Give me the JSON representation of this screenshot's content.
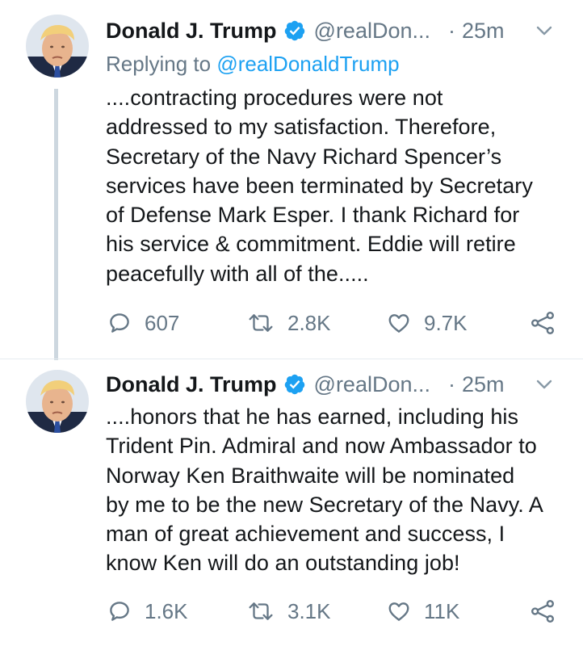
{
  "colors": {
    "text": "#14171a",
    "secondary": "#657786",
    "link": "#1da1f2",
    "verified": "#1da1f2",
    "thread_line": "#cdd7df"
  },
  "tweets": [
    {
      "display_name": "Donald J. Trump",
      "verified_icon": "verified-badge-icon",
      "handle": "@realDon...",
      "separator": "·",
      "time": "25m",
      "menu_icon": "chevron-down-icon",
      "reply_prefix": "Replying to",
      "reply_to": "@realDonaldTrump",
      "text": "....contracting procedures were not\naddressed to my satisfaction. Therefore,\nSecretary of the Navy Richard Spencer’s\nservices have been terminated by Secretary\nof Defense Mark Esper. I thank Richard for\nhis service & commitment. Eddie will retire\npeacefully with all of the.....",
      "replies": "607",
      "retweets": "2.8K",
      "likes": "9.7K"
    },
    {
      "display_name": "Donald J. Trump",
      "verified_icon": "verified-badge-icon",
      "handle": "@realDon...",
      "separator": "·",
      "time": "25m",
      "menu_icon": "chevron-down-icon",
      "text": "....honors that he has earned, including his\nTrident Pin. Admiral and now Ambassador to\nNorway Ken Braithwaite will be nominated\nby me to be the new Secretary of the Navy. A\nman of great achievement and success, I\nknow Ken will do an outstanding job!",
      "replies": "1.6K",
      "retweets": "3.1K",
      "likes": "11K"
    }
  ]
}
